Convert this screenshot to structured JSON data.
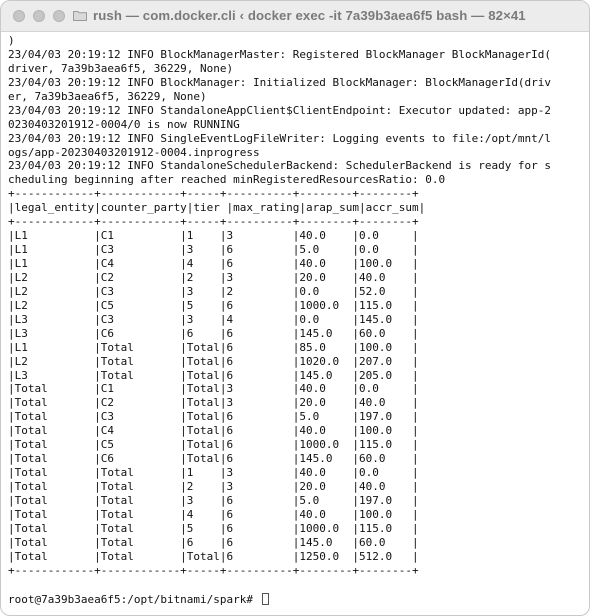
{
  "window": {
    "title": "rush — com.docker.cli ‹ docker exec -it 7a39b3aea6f5 bash — 82×41"
  },
  "terminal": {
    "lines": [
      ")",
      "23/04/03 20:19:12 INFO BlockManagerMaster: Registered BlockManager BlockManagerId(",
      "driver, 7a39b3aea6f5, 36229, None)",
      "23/04/03 20:19:12 INFO BlockManager: Initialized BlockManager: BlockManagerId(driv",
      "er, 7a39b3aea6f5, 36229, None)",
      "23/04/03 20:19:12 INFO StandaloneAppClient$ClientEndpoint: Executor updated: app-2",
      "0230403201912-0004/0 is now RUNNING",
      "23/04/03 20:19:12 INFO SingleEventLogFileWriter: Logging events to file:/opt/mnt/l",
      "ogs/app-20230403201912-0004.inprogress",
      "23/04/03 20:19:12 INFO StandaloneSchedulerBackend: SchedulerBackend is ready for s",
      "cheduling beginning after reached minRegisteredResourcesRatio: 0.0",
      "+------------+------------+-----+----------+--------+--------+",
      "|legal_entity|counter_party|tier |max_rating|arap_sum|accr_sum|",
      "+------------+------------+-----+----------+--------+--------+",
      "|L1          |C1          |1    |3         |40.0    |0.0     |",
      "|L1          |C3          |3    |6         |5.0     |0.0     |",
      "|L1          |C4          |4    |6         |40.0    |100.0   |",
      "|L2          |C2          |2    |3         |20.0    |40.0    |",
      "|L2          |C3          |3    |2         |0.0     |52.0    |",
      "|L2          |C5          |5    |6         |1000.0  |115.0   |",
      "|L3          |C3          |3    |4         |0.0     |145.0   |",
      "|L3          |C6          |6    |6         |145.0   |60.0    |",
      "|L1          |Total       |Total|6         |85.0    |100.0   |",
      "|L2          |Total       |Total|6         |1020.0  |207.0   |",
      "|L3          |Total       |Total|6         |145.0   |205.0   |",
      "|Total       |C1          |Total|3         |40.0    |0.0     |",
      "|Total       |C2          |Total|3         |20.0    |40.0    |",
      "|Total       |C3          |Total|6         |5.0     |197.0   |",
      "|Total       |C4          |Total|6         |40.0    |100.0   |",
      "|Total       |C5          |Total|6         |1000.0  |115.0   |",
      "|Total       |C6          |Total|6         |145.0   |60.0    |",
      "|Total       |Total       |1    |3         |40.0    |0.0     |",
      "|Total       |Total       |2    |3         |20.0    |40.0    |",
      "|Total       |Total       |3    |6         |5.0     |197.0   |",
      "|Total       |Total       |4    |6         |40.0    |100.0   |",
      "|Total       |Total       |5    |6         |1000.0  |115.0   |",
      "|Total       |Total       |6    |6         |145.0   |60.0    |",
      "|Total       |Total       |Total|6         |1250.0  |512.0   |",
      "+------------+------------+-----+----------+--------+--------+",
      ""
    ],
    "prompt": "root@7a39b3aea6f5:/opt/bitnami/spark#"
  }
}
